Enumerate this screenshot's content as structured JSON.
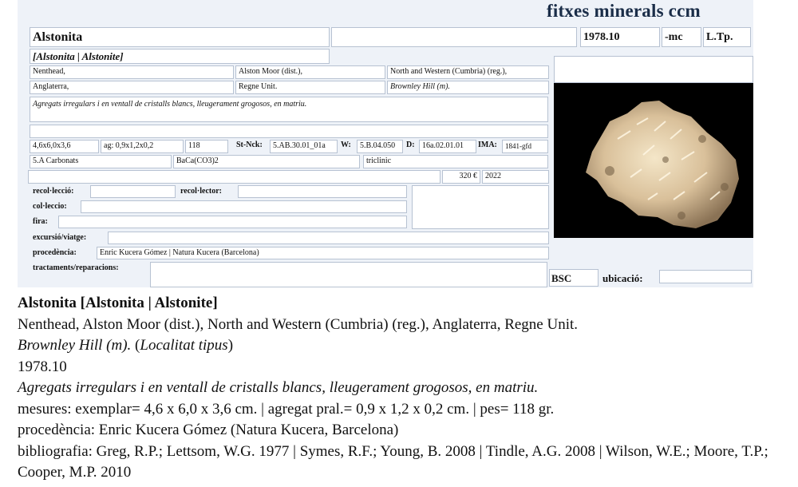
{
  "header": {
    "brand": "fitxes minerals ccm"
  },
  "card": {
    "name": "Alstonita",
    "code": "1978.10",
    "suffix": "-mc",
    "type_tag": "L.Tp.",
    "alt_names": "[Alstonita | Alstonite]",
    "loc1": "Nenthead,",
    "loc2": "Alston Moor (dist.),",
    "loc3": "North and Western (Cumbria) (reg.),",
    "loc4": "Anglaterra,",
    "loc5": "Regne Unit.",
    "loc6": "Brownley Hill (m).",
    "description": "Agregats irregulars i en ventall de cristalls blancs, lleugerament grogosos, en matriu.",
    "dims": "4,6x6,0x3,6",
    "agg": "ag: 0,9x1,2x0,2",
    "weight": "118",
    "stnck_label": "St-Nck:",
    "stnck": "5.AB.30.01_01a",
    "w_label": "W:",
    "w": "5.B.04.050",
    "d_label": "D:",
    "d": "16a.02.01.01",
    "ima_label": "IMA:",
    "ima": "1841-gfd",
    "class": "5.A Carbonats",
    "formula": "BaCa(CO3)2",
    "system": "triclinic",
    "price": "320 €",
    "year": "2022",
    "recollection_label": "recol·lecció:",
    "recollector_label": "recol·lector:",
    "collection_label": "col·leccio:",
    "fair_label": "fira:",
    "excursion_label": "excursió/viatge:",
    "provenance_label": "procedència:",
    "provenance": "Enric Kucera Gómez | Natura Kucera (Barcelona)",
    "treatments_label": "tractaments/reparacions:",
    "bsc": "BSC",
    "location_label": "ubicació:"
  },
  "summary": {
    "title": "Alstonita [Alstonita | Alstonite]",
    "locality": "Nenthead, Alston Moor (dist.), North and Western (Cumbria) (reg.), Anglaterra, Regne Unit.",
    "mine": "Brownley Hill (m).",
    "type_locality_open": " (",
    "type_locality": "Localitat tipus",
    "type_locality_close": ")",
    "code": "1978.10",
    "description": "Agregats irregulars i en ventall de cristalls blancs, lleugerament grogosos, en matriu.",
    "measures": "mesures: exemplar= 4,6 x 6,0 x 3,6 cm. | agregat pral.= 0,9 x 1,2 x 0,2 cm. | pes= 118 gr.",
    "provenance": "procedència: Enric Kucera Gómez (Natura Kucera, Barcelona)",
    "bibliography": "bibliografia: Greg, R.P.; Lettsom, W.G. 1977 | Symes, R.F.; Young, B. 2008 | Tindle, A.G. 2008 | Wilson, W.E.; Moore, T.P.; Cooper, M.P. 2010"
  }
}
